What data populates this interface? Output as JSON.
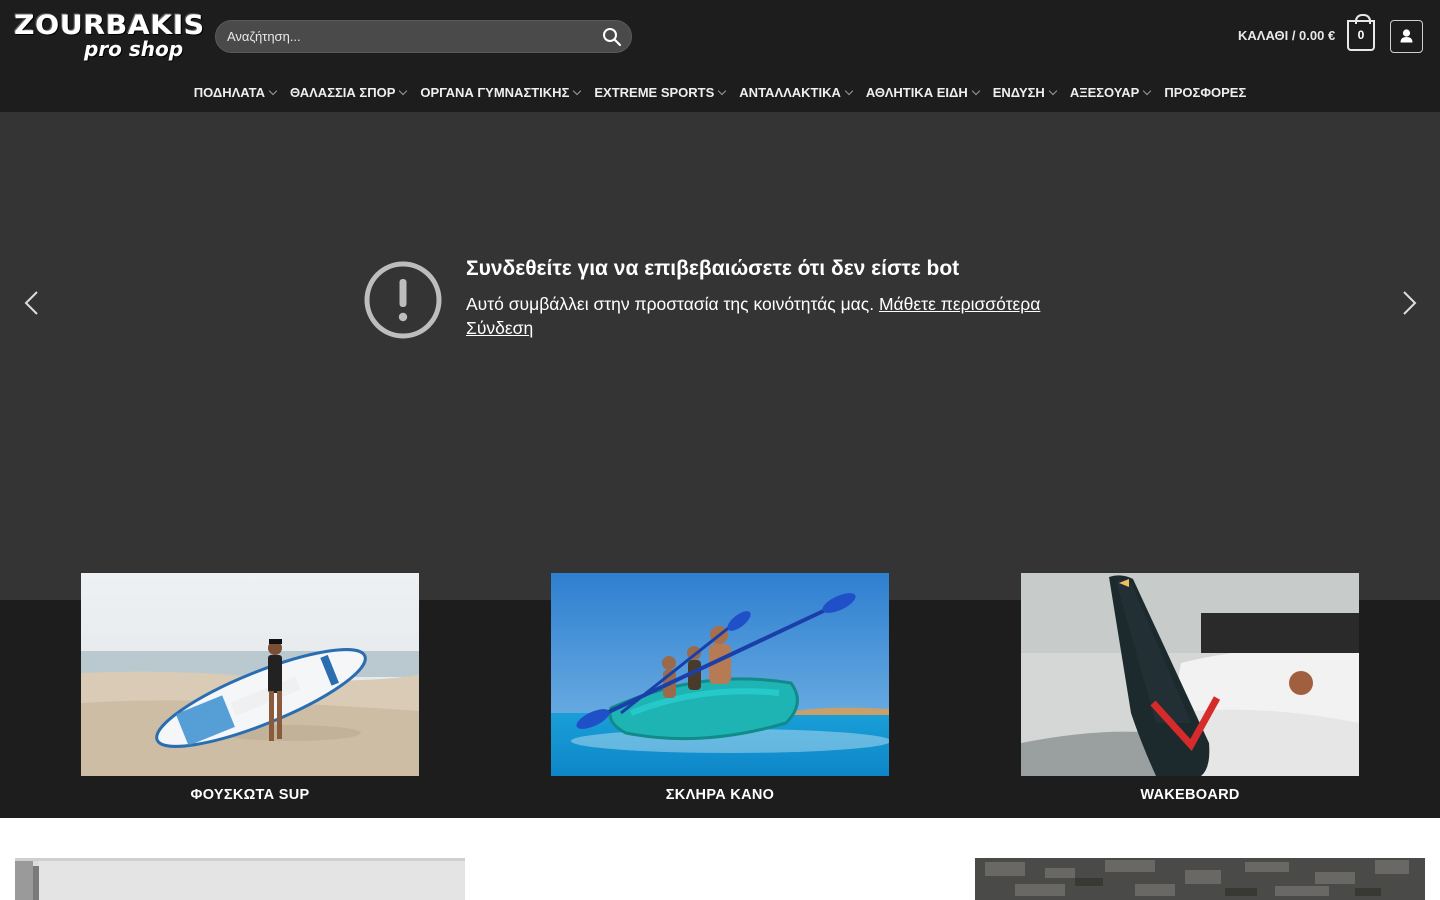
{
  "logo": {
    "line1": "ZOURBAKIS",
    "line2": "pro shop"
  },
  "search": {
    "placeholder": "Αναζήτηση..."
  },
  "cart": {
    "label": "ΚΑΛΑΘΙ / 0.00 €",
    "count": "0"
  },
  "nav": {
    "items": [
      {
        "label": "ΠΟΔΗΛΑΤΑ"
      },
      {
        "label": "ΘΑΛΑΣΣΙΑ ΣΠΟΡ"
      },
      {
        "label": "ΟΡΓΑΝΑ ΓΥΜΝΑΣΤΙΚΗΣ"
      },
      {
        "label": "EXTREME SPORTS"
      },
      {
        "label": "ΑΝΤΑΛΛΑΚΤΙΚΑ"
      },
      {
        "label": "ΑΘΛΗΤΙΚΑ ΕΙΔΗ"
      },
      {
        "label": "ΕΝΔΥΣΗ"
      },
      {
        "label": "ΑΞΕΣΟΥΑΡ"
      },
      {
        "label": "ΠΡΟΣΦΟΡΕΣ"
      }
    ]
  },
  "hero": {
    "title": "Συνδεθείτε για να επιβεβαιώσετε ότι δεν είστε bot",
    "text": "Αυτό συμβάλλει στην προστασία της κοινότητάς μας.",
    "learn_more": "Μάθετε περισσότερα",
    "login": "Σύνδεση"
  },
  "categories": [
    {
      "label": "ΦΟΥΣΚΩΤΑ SUP"
    },
    {
      "label": "ΣΚΛΗΡΑ ΚΑΝΟ"
    },
    {
      "label": "WAKEBOARD"
    }
  ],
  "colors": {
    "header_bg": "#1d1d1d",
    "hero_bg": "#343434",
    "text": "#ffffff"
  }
}
